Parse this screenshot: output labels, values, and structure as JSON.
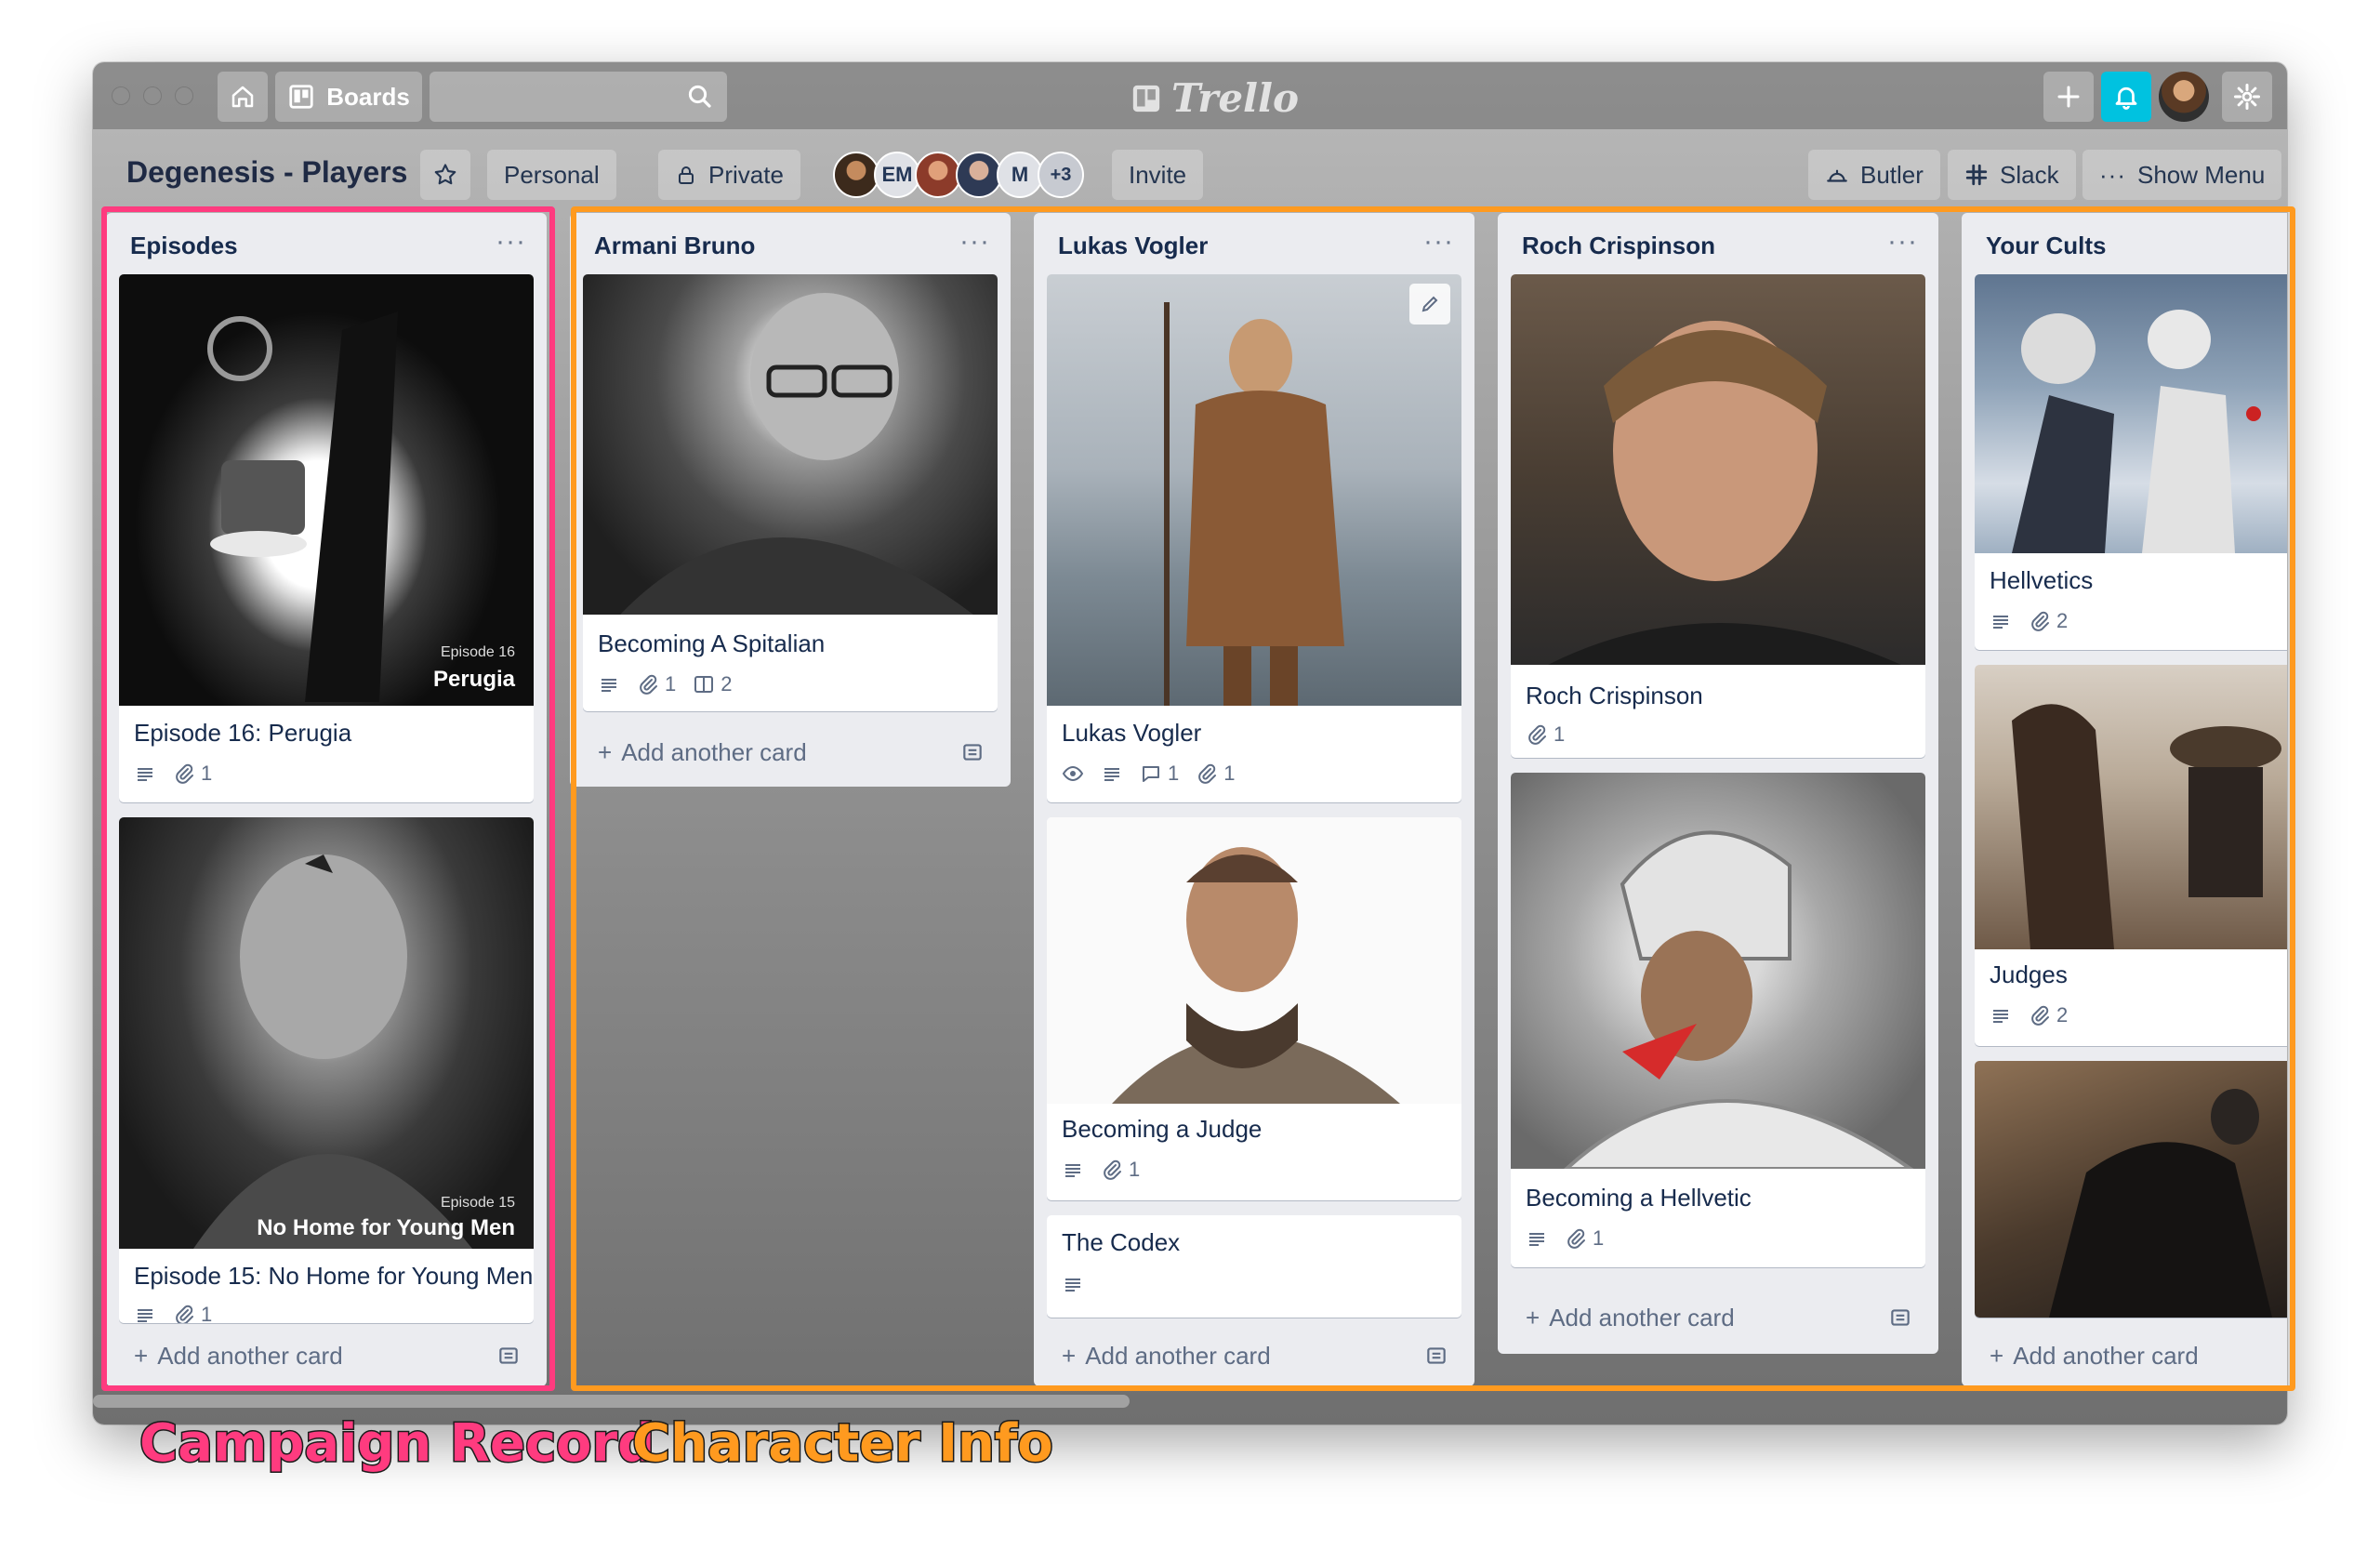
{
  "app": {
    "logo_text": "Trello"
  },
  "titlebar": {
    "boards_label": "Boards",
    "search_value": ""
  },
  "board": {
    "title": "Degenesis - Players",
    "team_label": "Personal",
    "visibility_label": "Private",
    "members": [
      "EM",
      "M"
    ],
    "more_members": "+3",
    "invite_label": "Invite",
    "butler_label": "Butler",
    "slack_label": "Slack",
    "show_menu_label": "Show Menu"
  },
  "lists": [
    {
      "title": "Episodes",
      "cards": [
        {
          "title": "Episode 16: Perugia",
          "cover_kicker": "Episode 16",
          "cover_title": "Perugia",
          "badges": {
            "description": true,
            "attachments": "1"
          }
        },
        {
          "title": "Episode 15: No Home for Young Men",
          "cover_kicker": "Episode 15",
          "cover_title": "No Home for Young Men",
          "badges": {
            "description": true,
            "attachments": "1"
          }
        }
      ],
      "add_label": "Add another card"
    },
    {
      "title": "Armani Bruno",
      "cards": [
        {
          "title": "Becoming A Spitalian",
          "badges": {
            "description": true,
            "attachments": "1",
            "checklist": "2"
          }
        }
      ],
      "add_label": "Add another card"
    },
    {
      "title": "Lukas Vogler",
      "cards": [
        {
          "title": "Lukas Vogler",
          "badges": {
            "watching": true,
            "description": true,
            "comments": "1",
            "attachments": "1"
          }
        },
        {
          "title": "Becoming a Judge",
          "badges": {
            "description": true,
            "attachments": "1"
          }
        },
        {
          "title": "The Codex",
          "badges": {
            "description": true
          }
        }
      ],
      "add_label": "Add another card"
    },
    {
      "title": "Roch Crispinson",
      "cards": [
        {
          "title": "Roch Crispinson",
          "badges": {
            "attachments": "1"
          }
        },
        {
          "title": "Becoming a Hellvetic",
          "badges": {
            "description": true,
            "attachments": "1"
          }
        }
      ],
      "add_label": "Add another card"
    },
    {
      "title": "Your Cults",
      "cards": [
        {
          "title": "Hellvetics",
          "badges": {
            "description": true,
            "attachments": "2"
          }
        },
        {
          "title": "Judges",
          "badges": {
            "description": true,
            "attachments": "2"
          }
        }
      ],
      "add_label": "Add another card"
    }
  ],
  "annotations": {
    "campaign": "Campaign Record",
    "character": "Character Info",
    "campaign_color": "#ff3b7f",
    "character_color": "#ff9a1f"
  },
  "colors": {
    "notification": "#00c2e0",
    "list_bg": "#ebecf0",
    "text": "#172b4d"
  }
}
